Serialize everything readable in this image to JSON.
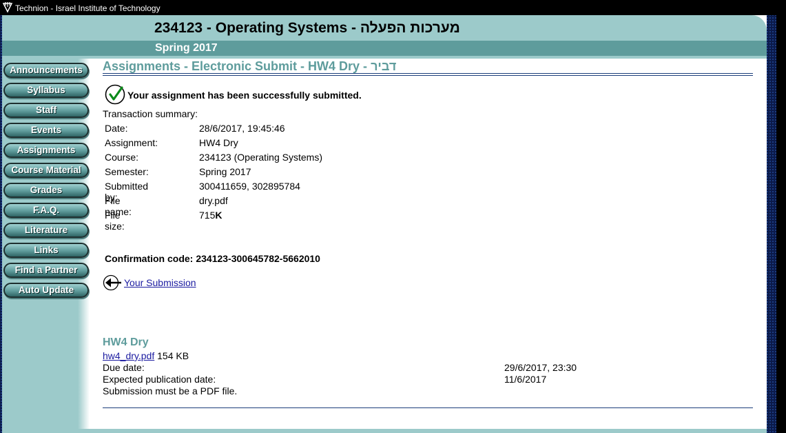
{
  "window": {
    "title": "Technion - Israel Institute of Technology"
  },
  "header": {
    "course_title": "234123 - Operating Systems - מערכות הפעלה",
    "semester": "Spring 2017"
  },
  "sidebar": {
    "items": [
      {
        "label": "Announcements"
      },
      {
        "label": "Syllabus"
      },
      {
        "label": "Staff"
      },
      {
        "label": "Events"
      },
      {
        "label": "Assignments"
      },
      {
        "label": "Course Material"
      },
      {
        "label": "Grades"
      },
      {
        "label": "F.A.Q."
      },
      {
        "label": "Literature"
      },
      {
        "label": "Links"
      },
      {
        "label": "Find a Partner"
      },
      {
        "label": "Auto Update"
      }
    ]
  },
  "main": {
    "heading": "Assignments - Electronic Submit - HW4 Dry - דביר",
    "success_message": "Your assignment has been successfully submitted.",
    "summary_label": "Transaction summary:",
    "summary": [
      {
        "key": "Date:",
        "value": "28/6/2017, 19:45:46"
      },
      {
        "key": "Assignment:",
        "value": "HW4 Dry"
      },
      {
        "key": "Course:",
        "value": "234123 (Operating Systems)"
      },
      {
        "key": "Semester:",
        "value": "Spring 2017"
      },
      {
        "key": "Submitted by:",
        "value": "300411659, 302895784"
      },
      {
        "key": "File name:",
        "value": "dry.pdf"
      }
    ],
    "file_size": {
      "key": "File size:",
      "number": "715",
      "unit": "K"
    },
    "confirmation": {
      "label": "Confirmation code:",
      "value": "234123-300645782-5662010"
    },
    "submission_link": "Your Submission",
    "assignment": {
      "title": "HW4 Dry",
      "file_link": "hw4_dry.pdf",
      "file_size": "154 KB",
      "due_label": "Due date:",
      "due_value": "29/6/2017, 23:30",
      "pub_label": "Expected publication date:",
      "pub_value": "11/6/2017",
      "note": "Submission must be a PDF file."
    }
  },
  "colors": {
    "teal_light": "#9ccaca",
    "teal_dark": "#5e9c9c",
    "link": "#1a1aa0",
    "rule": "#1b3d7a",
    "background": "#0b1a4a"
  }
}
